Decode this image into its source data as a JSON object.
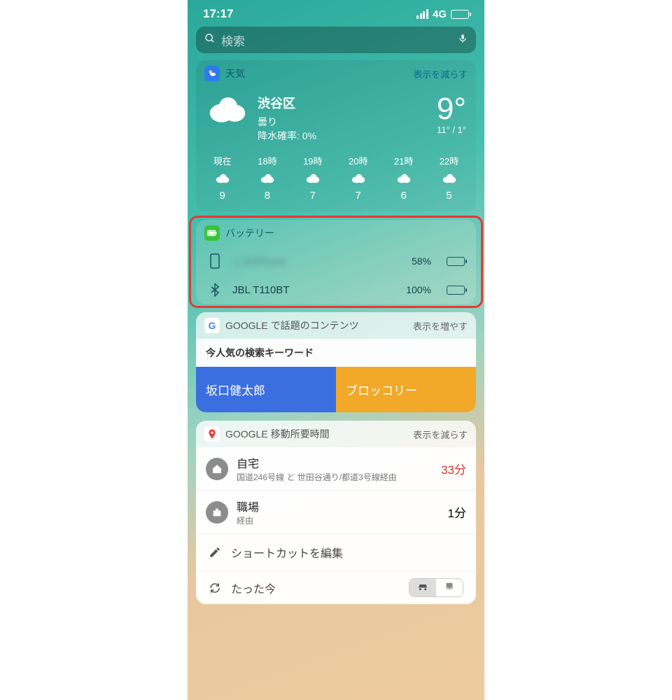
{
  "status": {
    "time": "17:17",
    "network": "4G"
  },
  "search": {
    "placeholder": "検索"
  },
  "weather": {
    "title": "天気",
    "action": "表示を減らす",
    "location": "渋谷区",
    "condition": "曇り",
    "precip": "降水確率: 0%",
    "temp": "9°",
    "hilo": "11° / 1°",
    "hourly": [
      {
        "label": "現在",
        "temp": "9"
      },
      {
        "label": "18時",
        "temp": "8"
      },
      {
        "label": "19時",
        "temp": "7"
      },
      {
        "label": "20時",
        "temp": "7"
      },
      {
        "label": "21時",
        "temp": "6"
      },
      {
        "label": "22時",
        "temp": "5"
      }
    ]
  },
  "battery": {
    "title": "バッテリー",
    "devices": [
      {
        "name": "このiPhone",
        "percent": "58%",
        "fill": 58
      },
      {
        "name": "JBL T110BT",
        "percent": "100%",
        "fill": 100
      }
    ]
  },
  "google_trends": {
    "title": "GOOGLE で話題のコンテンツ",
    "action": "表示を増やす",
    "header": "今人気の検索キーワード",
    "items": [
      "坂口健太郎",
      "ブロッコリー"
    ]
  },
  "travel": {
    "title": "GOOGLE 移動所要時間",
    "action": "表示を減らす",
    "rows": [
      {
        "name": "自宅",
        "sub": "国道246号線 と 世田谷通り/都道3号線経由",
        "time": "33分",
        "red": true
      },
      {
        "name": "職場",
        "sub": "経由",
        "time": "1分",
        "red": false
      }
    ],
    "edit": "ショートカットを編集",
    "footer": "たった今"
  }
}
